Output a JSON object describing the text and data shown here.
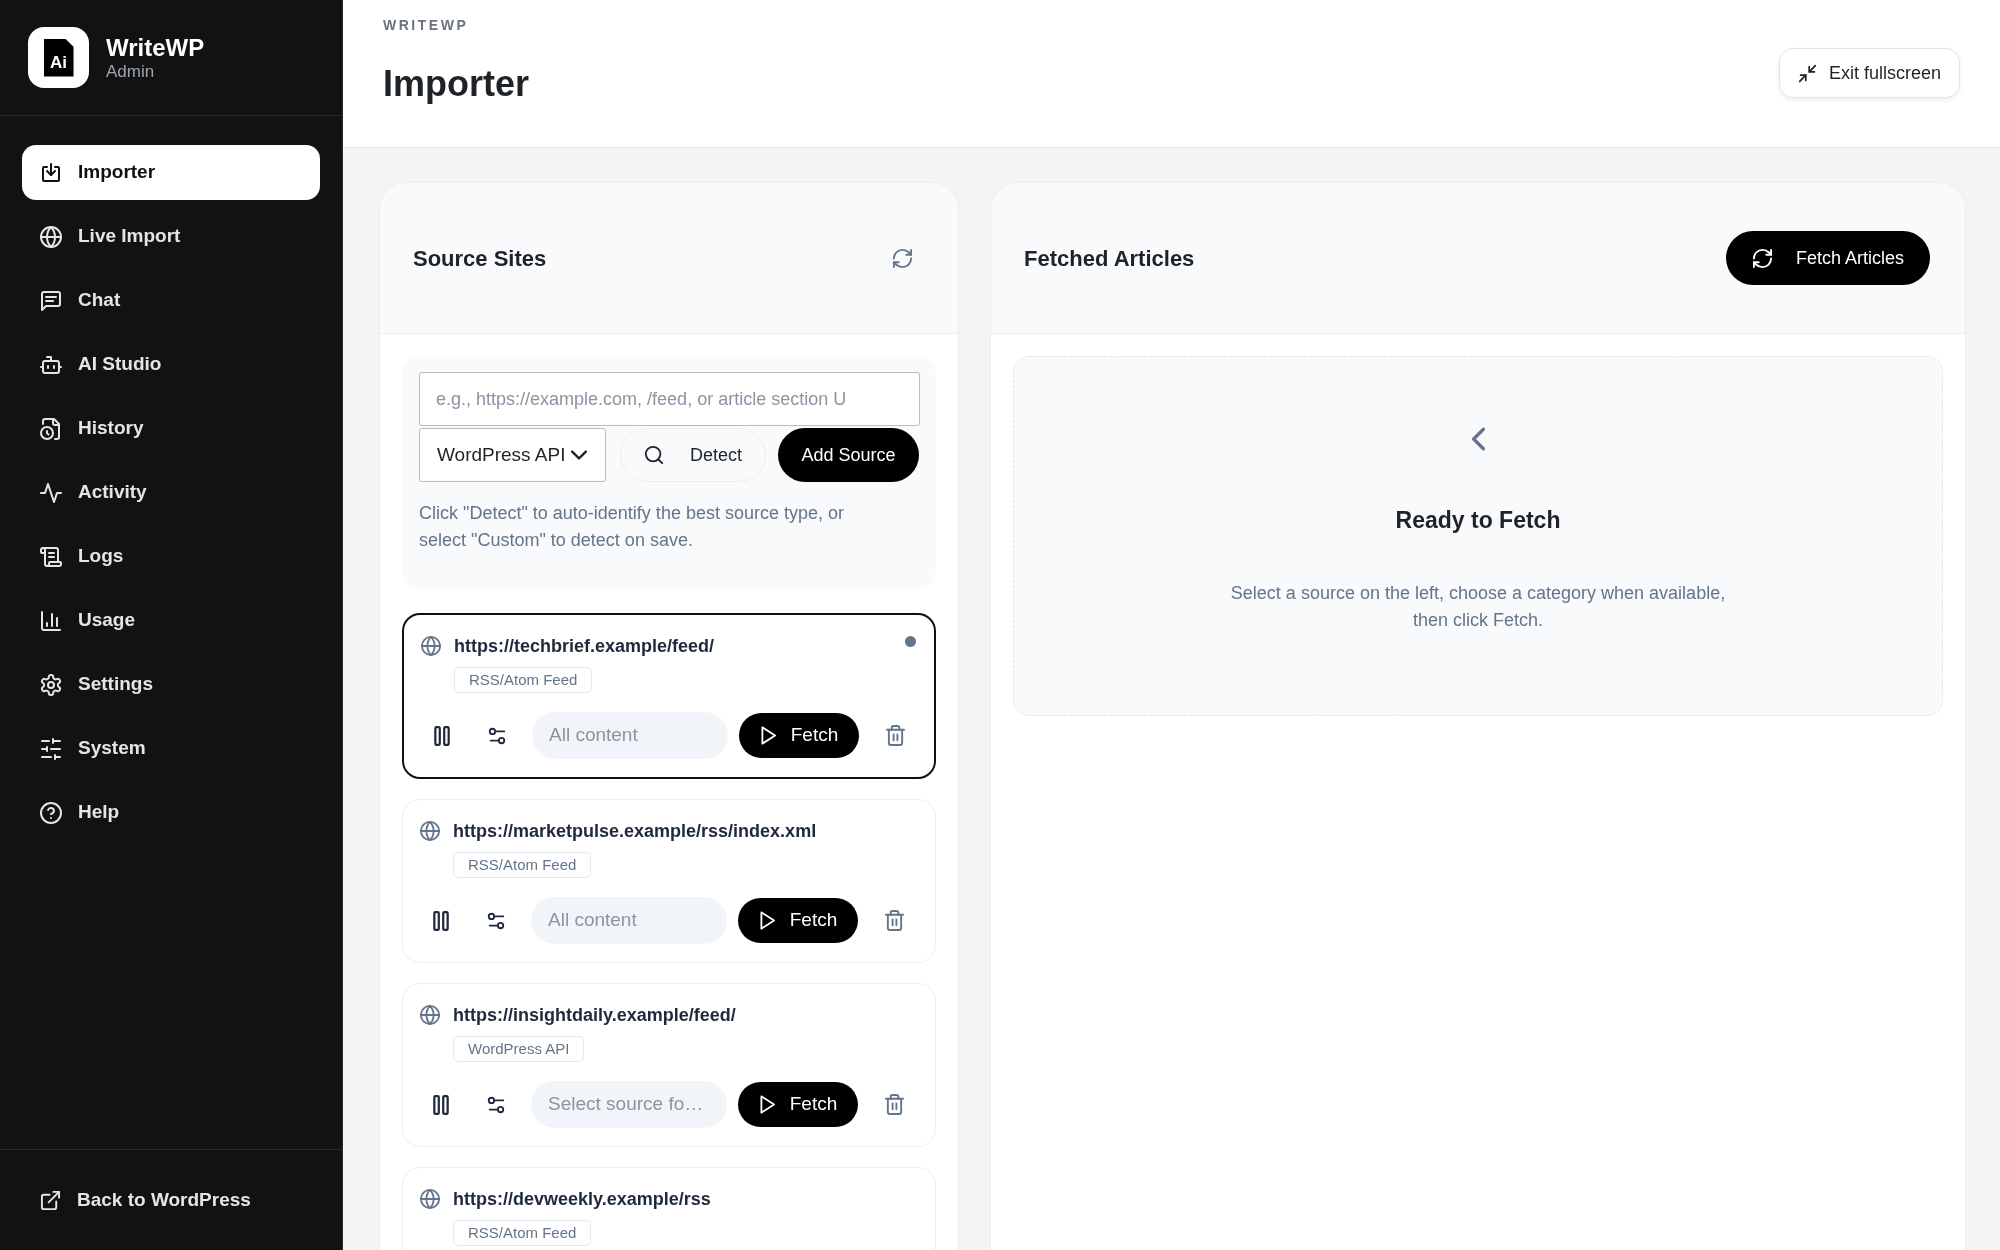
{
  "sidebar": {
    "brand": {
      "logo_text": "Ai",
      "name": "WriteWP",
      "role": "Admin"
    },
    "items": [
      {
        "label": "Importer",
        "selected": true
      },
      {
        "label": "Live Import",
        "selected": false
      },
      {
        "label": "Chat",
        "selected": false
      },
      {
        "label": "AI Studio",
        "selected": false
      },
      {
        "label": "History",
        "selected": false
      },
      {
        "label": "Activity",
        "selected": false
      },
      {
        "label": "Logs",
        "selected": false
      },
      {
        "label": "Usage",
        "selected": false
      },
      {
        "label": "Settings",
        "selected": false
      },
      {
        "label": "System",
        "selected": false
      },
      {
        "label": "Help",
        "selected": false
      }
    ],
    "footer_link": "Back to WordPress"
  },
  "header": {
    "eyebrow": "WRITEWP",
    "title": "Importer",
    "action": "Exit fullscreen"
  },
  "source_panel": {
    "title": "Source Sites",
    "url_field": {
      "placeholder": "e.g., https://example.com, /feed, or article section U"
    },
    "source_type": "WordPress API",
    "detect": "Detect",
    "add": "Add Source",
    "hint": "Click \"Detect\" to auto-identify the best source type, or select \"Custom\" to detect on save.",
    "sources": [
      {
        "url": "https://techbrief.example/feed/",
        "type": "RSS/Atom Feed",
        "category": "All content",
        "fetch": "Fetch",
        "selected": true
      },
      {
        "url": "https://marketpulse.example/rss/index.xml",
        "type": "RSS/Atom Feed",
        "category": "All content",
        "fetch": "Fetch",
        "selected": false
      },
      {
        "url": "https://insightdaily.example/feed/",
        "type": "WordPress API",
        "category": "Select source fo…",
        "fetch": "Fetch",
        "selected": false
      },
      {
        "url": "https://devweekly.example/rss",
        "type": "RSS/Atom Feed",
        "selected": false
      }
    ]
  },
  "articles_panel": {
    "title": "Fetched Articles",
    "action": "Fetch Articles",
    "empty_state": {
      "title": "Ready to Fetch",
      "message": "Select a source on the left, choose a category when available, then click Fetch."
    }
  }
}
